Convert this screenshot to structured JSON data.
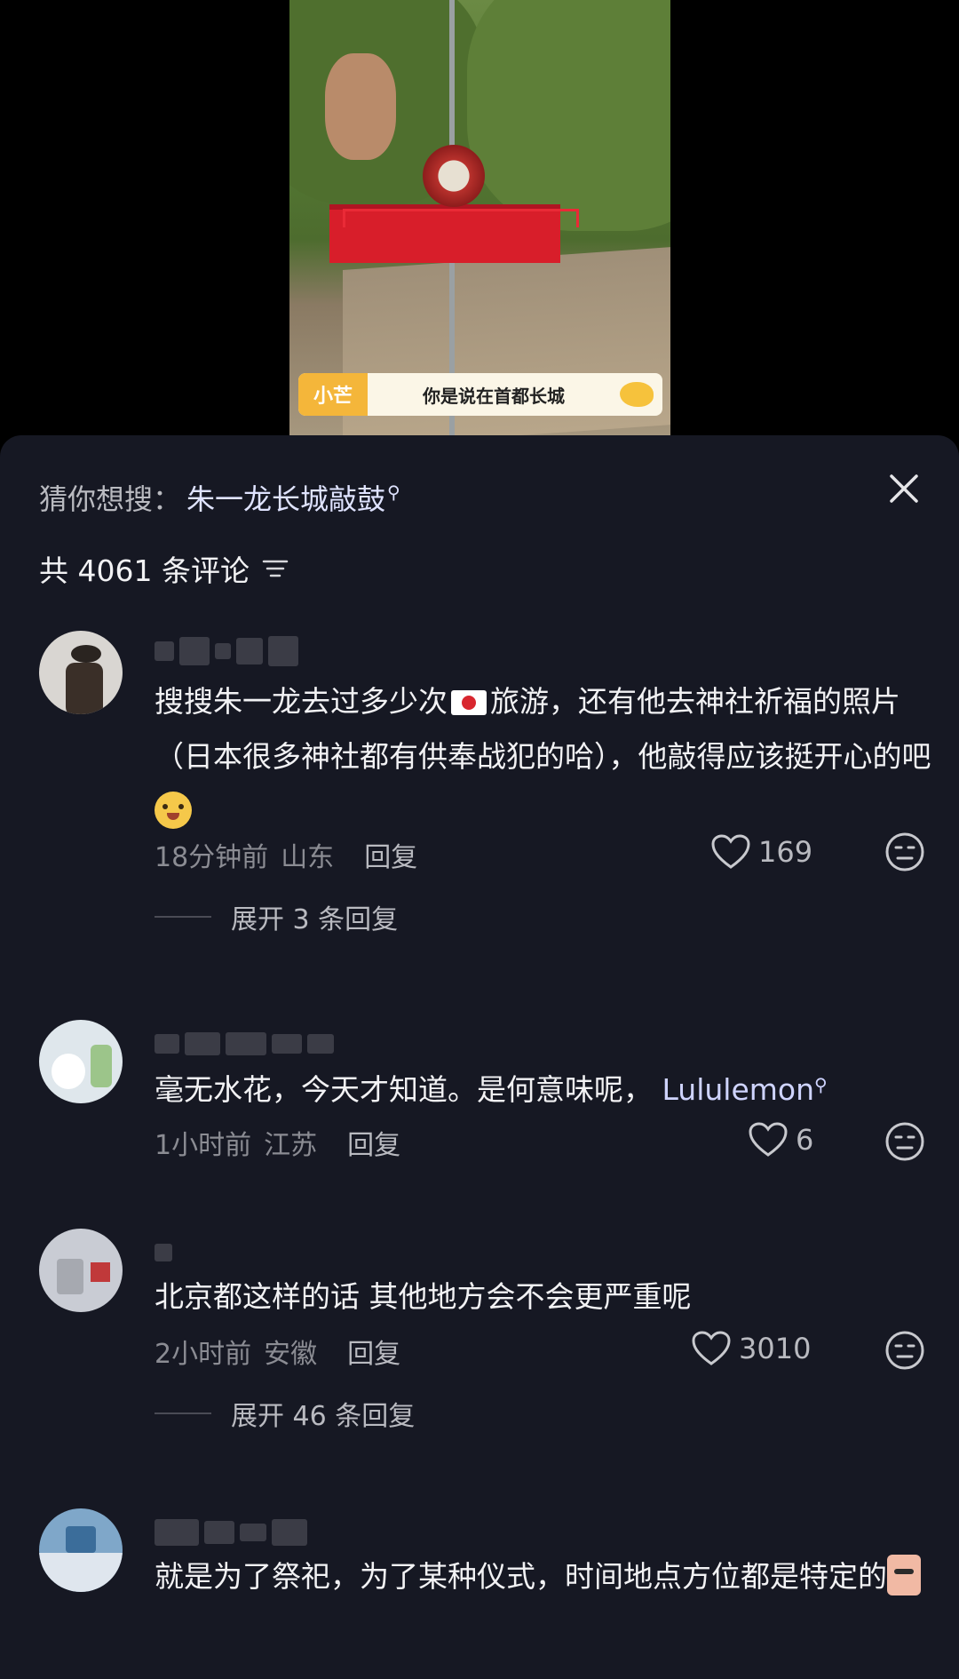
{
  "video": {
    "brand_tag": "小芒",
    "caption": "你是说在首都长城"
  },
  "panel": {
    "suggest_label": "猜你想搜：",
    "suggest_keyword": "朱一龙长城敲鼓",
    "comment_count_text": "共 4061 条评论"
  },
  "comments": [
    {
      "text_before": "搜搜朱一龙去过多少次",
      "text_after": "旅游，还有他去神社祈福的照片（日本很多神社都有供奉战犯的哈），他敲得应该挺开心的吧",
      "time": "18分钟前",
      "location": "山东",
      "reply_label": "回复",
      "likes": "169",
      "expand_text": "展开 3 条回复"
    },
    {
      "text": "毫无水花，今天才知道。是何意味呢，",
      "keyword": "Lululemon",
      "time": "1小时前",
      "location": "江苏",
      "reply_label": "回复",
      "likes": "6"
    },
    {
      "text": "北京都这样的话 其他地方会不会更严重呢",
      "time": "2小时前",
      "location": "安徽",
      "reply_label": "回复",
      "likes": "3010",
      "expand_text": "展开 46 条回复"
    },
    {
      "text": "就是为了祭祀，为了某种仪式，时间地点方位都是特定的"
    }
  ],
  "colors": {
    "panel_bg": "#161823",
    "text_primary": "#f2f2f4",
    "text_secondary": "#8b8c93",
    "keyword_link": "#dfe3ff"
  }
}
